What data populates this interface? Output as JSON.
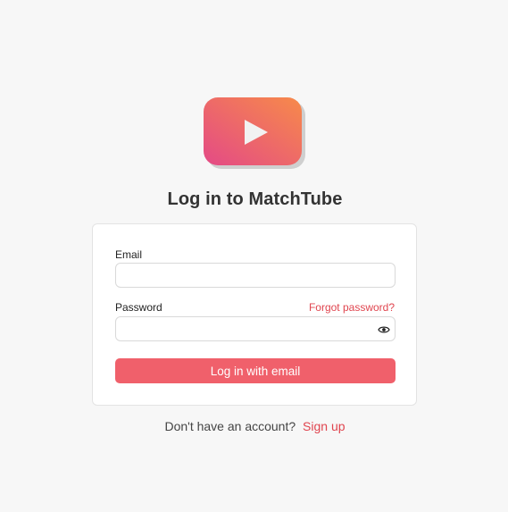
{
  "brand": {
    "logo_icon": "play-button-icon",
    "gradient_start": "#e44a86",
    "gradient_end": "#f78a4a"
  },
  "page": {
    "title": "Log in to MatchTube"
  },
  "form": {
    "email_label": "Email",
    "email_value": "",
    "email_placeholder": "",
    "password_label": "Password",
    "password_value": "",
    "password_placeholder": "",
    "forgot_label": "Forgot password?",
    "show_password_icon": "eye-icon",
    "submit_label": "Log in with email"
  },
  "footer": {
    "prompt": "Don't have an account?",
    "signup_label": "Sign up"
  },
  "colors": {
    "background": "#f7f7f7",
    "accent": "#f0606b",
    "link": "#e0454f",
    "card": "#ffffff"
  }
}
